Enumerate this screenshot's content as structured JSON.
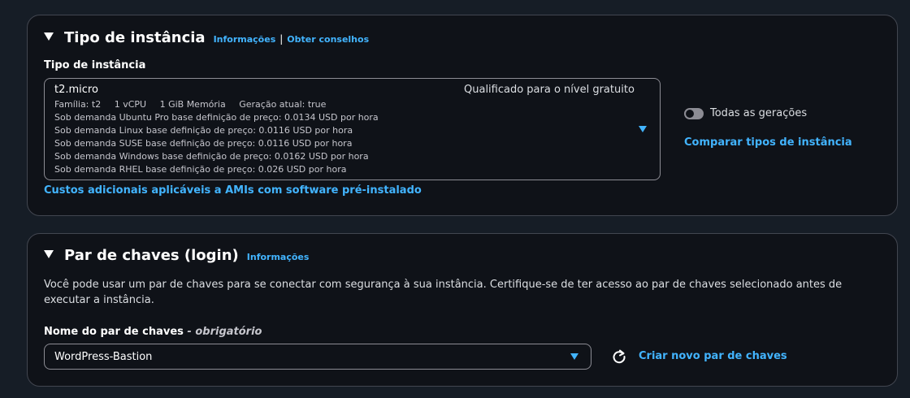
{
  "instance_section": {
    "title": "Tipo de instância",
    "info_link": "Informações",
    "separator": "|",
    "advice_link": "Obter conselhos",
    "field_label": "Tipo de instância",
    "selected": {
      "name": "t2.micro",
      "free_tier": "Qualificado para o nível gratuito",
      "family": "Família: t2",
      "vcpu": "1 vCPU",
      "memory": "1 GiB Memória",
      "generation": "Geração atual: true",
      "pricing": [
        "Sob demanda Ubuntu Pro base definição de preço: 0.0134 USD por hora",
        "Sob demanda Linux base definição de preço: 0.0116 USD por hora",
        "Sob demanda SUSE base definição de preço: 0.0116 USD por hora",
        "Sob demanda Windows base definição de preço: 0.0162 USD por hora",
        "Sob demanda RHEL base definição de preço: 0.026 USD por hora"
      ]
    },
    "all_generations_label": "Todas as gerações",
    "all_generations_enabled": false,
    "compare_link": "Comparar tipos de instância",
    "ami_costs_link": "Custos adicionais aplicáveis a AMIs com software pré-instalado"
  },
  "keypair_section": {
    "title": "Par de chaves (login)",
    "info_link": "Informações",
    "description": "Você pode usar um par de chaves para se conectar com segurança à sua instância. Certifique-se de ter acesso ao par de chaves selecionado antes de executar a instância.",
    "field_label": "Nome do par de chaves",
    "required_suffix": " - obrigatório",
    "selected_value": "WordPress-Bastion",
    "create_link": "Criar novo par de chaves"
  },
  "colors": {
    "background": "#161d26",
    "panel": "#0f1218",
    "accent_link": "#42b4ff",
    "border": "#424650"
  },
  "icons": {
    "collapse": "caret-down-icon",
    "dropdown": "dropdown-arrow-icon",
    "refresh": "refresh-icon"
  }
}
